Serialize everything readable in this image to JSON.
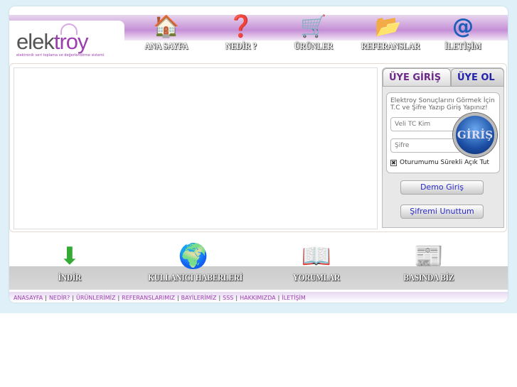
{
  "logo": {
    "name_a": "elek",
    "name_b": "troy",
    "tagline": "elektronik veri toplama ve değerlendirme sistemi"
  },
  "nav": [
    {
      "label": "ANA SAYFA",
      "icon": "house-icon"
    },
    {
      "label": "NEDİR ?",
      "icon": "question-cube-icon"
    },
    {
      "label": "ÜRÜNLER",
      "icon": "cart-icon"
    },
    {
      "label": "REFERANSLAR",
      "icon": "folder-icon"
    },
    {
      "label": "İLETİŞİM",
      "icon": "at-icon"
    }
  ],
  "login": {
    "tab_login": "ÜYE GİRİŞ",
    "tab_register": "ÜYE OL",
    "info": "Elektroy Sonuçlarını Görmek İçin T.C ve Şifre Yazıp Giriş Yapınız!",
    "tc_placeholder": "Veli TC Kim",
    "password_placeholder": "Şifre",
    "submit": "GİRİŞ",
    "remember": "Oturumumu Sürekli Açık Tut",
    "demo": "Demo Giriş",
    "forgot": "Şifremi Unuttum"
  },
  "bottom": [
    {
      "label": "İNDİR",
      "icon": "download-icon"
    },
    {
      "label": "KULLANICI HABERLERİ",
      "icon": "globe-icon"
    },
    {
      "label": "YORUMLAR",
      "icon": "book-icon"
    },
    {
      "label": "BASINDA BİZ",
      "icon": "newspaper-icon"
    }
  ],
  "footer": [
    "ANASAYFA",
    "NEDİR?",
    "ÜRÜNLERİMİZ",
    "REFERANSLARIMIZ",
    "BAYİLERİMİZ",
    "SSS",
    "HAKKIMIZDA",
    "İLETİŞİM"
  ]
}
